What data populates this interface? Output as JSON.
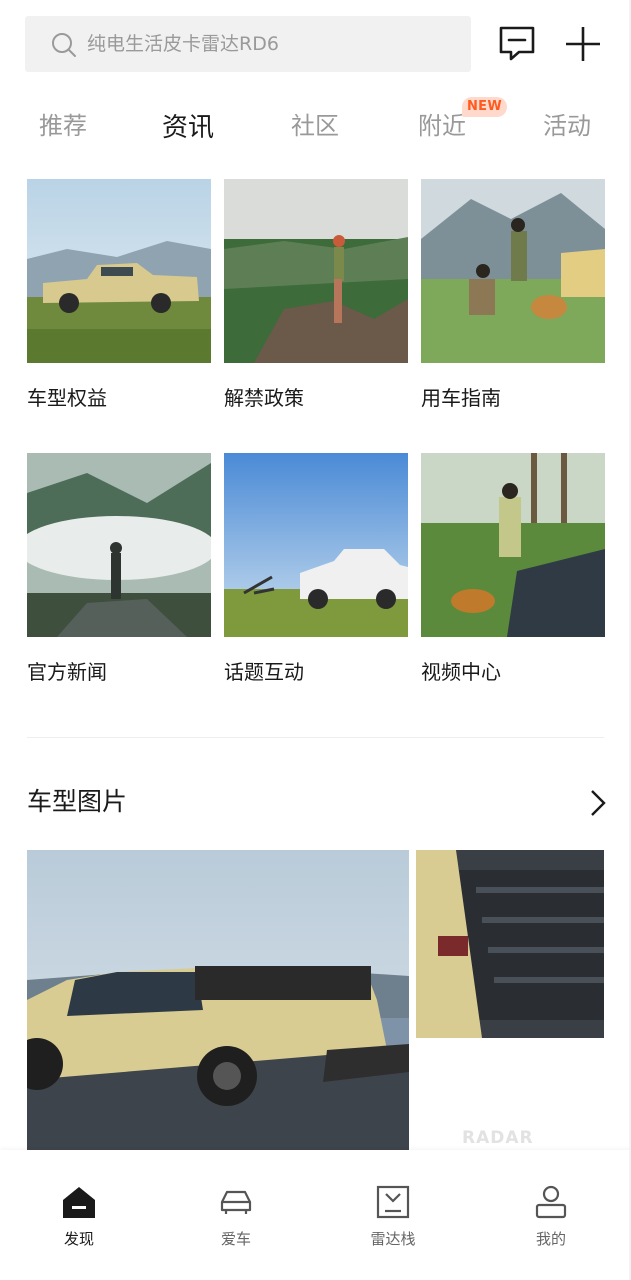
{
  "search": {
    "placeholder": "纯电生活皮卡雷达RD6"
  },
  "header_icons": [
    "message-icon",
    "plus-icon"
  ],
  "tabs": [
    {
      "label": "推荐",
      "active": false
    },
    {
      "label": "资讯",
      "active": true
    },
    {
      "label": "社区",
      "active": false
    },
    {
      "label": "附近",
      "active": false,
      "badge": "NEW"
    },
    {
      "label": "活动",
      "active": false
    }
  ],
  "grid": [
    {
      "label": "车型权益"
    },
    {
      "label": "解禁政策"
    },
    {
      "label": "用车指南"
    },
    {
      "label": "官方新闻"
    },
    {
      "label": "话题互动"
    },
    {
      "label": "视频中心"
    }
  ],
  "section": {
    "title": "车型图片"
  },
  "watermark": "RADAR",
  "bottom_nav": [
    {
      "label": "发现",
      "icon": "home-icon",
      "active": true
    },
    {
      "label": "爱车",
      "icon": "car-icon",
      "active": false
    },
    {
      "label": "雷达栈",
      "icon": "shopping-bag-icon",
      "active": false
    },
    {
      "label": "我的",
      "icon": "person-icon",
      "active": false
    }
  ],
  "colors": {
    "badge_bg": "#ffd9cc",
    "badge_text": "#ff5a1f",
    "active_text": "#1a1a1a",
    "inactive_text": "#999999"
  }
}
